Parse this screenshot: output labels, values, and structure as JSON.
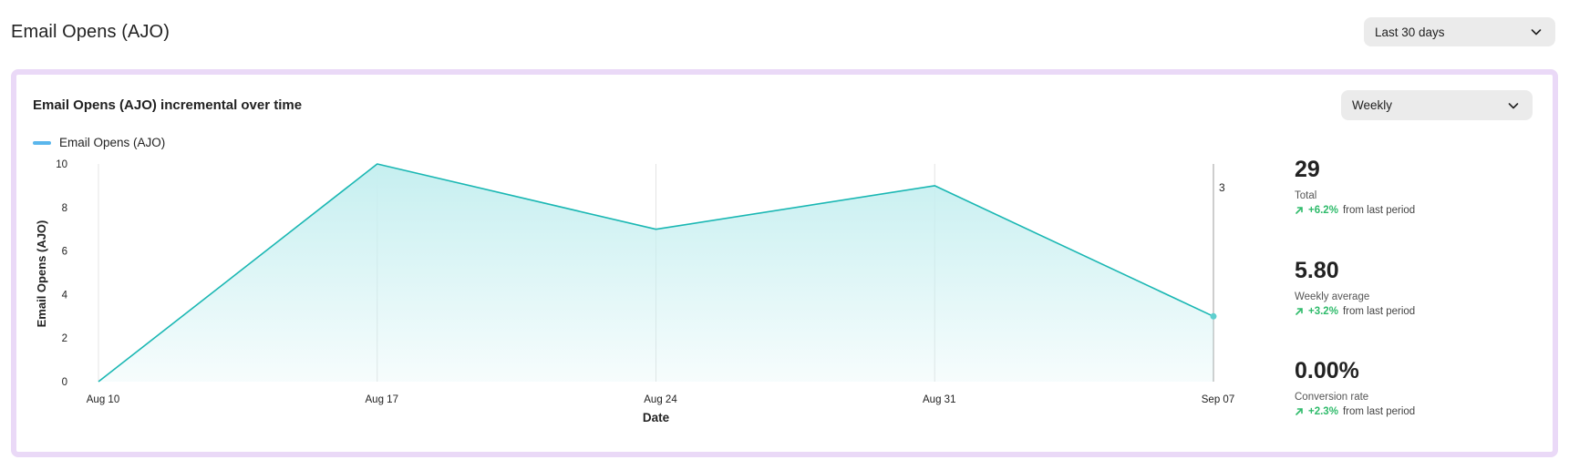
{
  "header": {
    "title": "Email Opens (AJO)",
    "range_dropdown": {
      "selected": "Last 30 days"
    }
  },
  "card": {
    "title": "Email Opens (AJO) incremental over time",
    "granularity_dropdown": {
      "selected": "Weekly"
    },
    "legend": {
      "label": "Email Opens (AJO)",
      "color": "#5ab6ec"
    }
  },
  "chart_data": {
    "type": "area",
    "x": [
      "Aug 10",
      "Aug 17",
      "Aug 24",
      "Aug 31",
      "Sep 07"
    ],
    "series": [
      {
        "name": "Email Opens (AJO)",
        "values": [
          0,
          10,
          7,
          9,
          3
        ]
      }
    ],
    "xlabel": "Date",
    "ylabel": "Email Opens (AJO)",
    "ylim": [
      0,
      10
    ],
    "yticks": [
      0,
      2,
      4,
      6,
      8,
      10
    ],
    "highlight": {
      "label": "3"
    },
    "grid": "vertical",
    "line_color": "#1ab7b3",
    "fill_color": "#c6eff0"
  },
  "kpis": [
    {
      "value": "29",
      "label": "Total",
      "delta": "+6.2%",
      "delta_suffix": "from last period"
    },
    {
      "value": "5.80",
      "label": "Weekly average",
      "delta": "+3.2%",
      "delta_suffix": "from last period"
    },
    {
      "value": "0.00%",
      "label": "Conversion rate",
      "delta": "+2.3%",
      "delta_suffix": "from last period"
    }
  ]
}
